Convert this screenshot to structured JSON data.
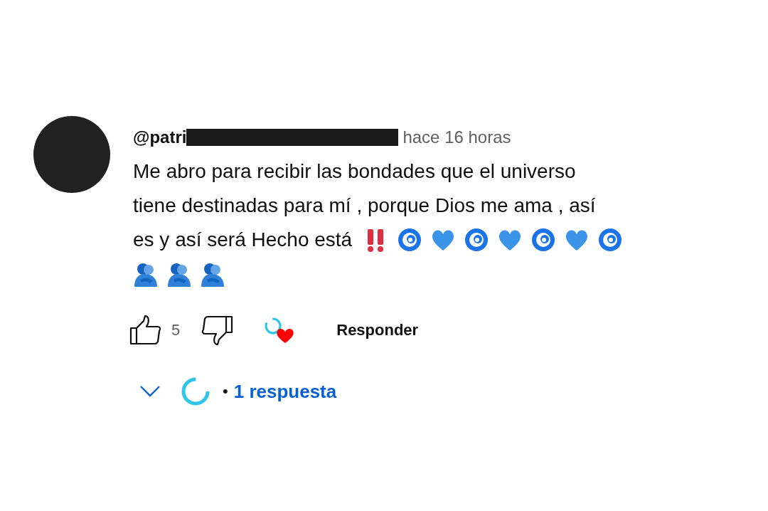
{
  "comment": {
    "author": "@patri",
    "author_redacted": true,
    "time": "hace 16 horas",
    "lines": [
      {
        "text": "Me abro para recibir las bondades que el universo"
      },
      {
        "text": "tiene destinadas para mí , porque Dios me ama , así"
      },
      {
        "text": "es y así será Hecho está",
        "emojis": [
          {
            "kind": "double-exclamation"
          },
          {
            "kind": "cyclone"
          },
          {
            "kind": "heart"
          },
          {
            "kind": "cyclone"
          },
          {
            "kind": "heart"
          },
          {
            "kind": "cyclone"
          },
          {
            "kind": "heart"
          },
          {
            "kind": "cyclone"
          }
        ]
      },
      {
        "emojis": [
          {
            "kind": "hug"
          },
          {
            "kind": "hug"
          },
          {
            "kind": "hug"
          }
        ]
      }
    ],
    "likes": "5",
    "creator_hearted": true,
    "reply_label": "Responder",
    "replies": {
      "expanded": false,
      "separator": "•",
      "label": "1 respuesta"
    }
  }
}
